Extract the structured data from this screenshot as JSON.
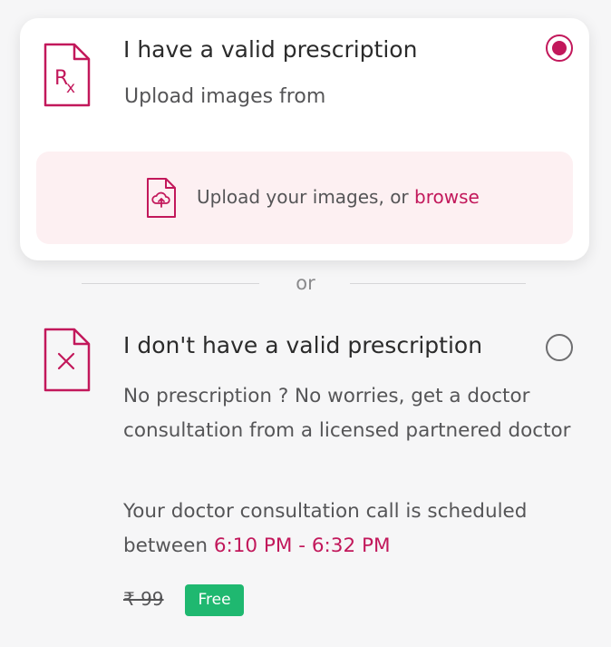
{
  "valid_option": {
    "title": "I have a valid prescription",
    "subtitle": "Upload images from",
    "selected": true,
    "icon": "rx-document-icon",
    "upload": {
      "text": "Upload your images, or ",
      "browse_label": "browse",
      "icon": "cloud-upload-document-icon"
    }
  },
  "divider": {
    "label": "or"
  },
  "no_prescription_option": {
    "title": "I don't have a valid prescription",
    "selected": false,
    "icon": "x-document-icon",
    "description": "No prescription ? No worries, get a doctor consultation from a licensed partnered doctor",
    "schedule_prefix": "Your doctor consultation call is scheduled between ",
    "schedule_time": "6:10 PM - 6:32 PM",
    "old_price": "₹ 99",
    "badge": "Free"
  },
  "colors": {
    "accent": "#c2185b",
    "upload_bg": "#fdf0f2",
    "badge_bg": "#1fb870",
    "page_bg": "#f6f6f7"
  }
}
